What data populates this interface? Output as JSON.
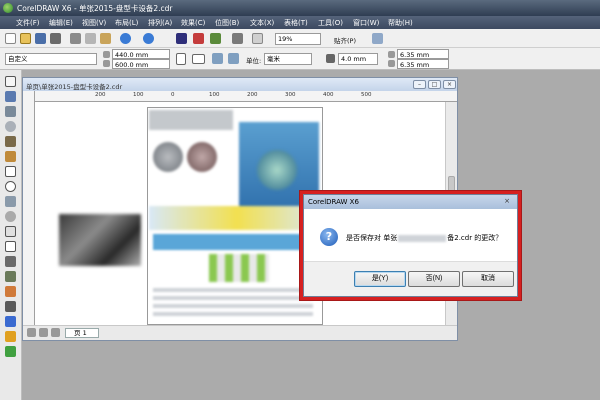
{
  "window": {
    "title": "CorelDRAW X6 - 单张2015-盘型卡设备2.cdr"
  },
  "menubar": {
    "items": [
      "文件(F)",
      "编辑(E)",
      "视图(V)",
      "布局(L)",
      "排列(A)",
      "效果(C)",
      "位图(B)",
      "文本(X)",
      "表格(T)",
      "工具(O)",
      "窗口(W)",
      "帮助(H)"
    ]
  },
  "toolbar": {
    "zoom": "19%",
    "snap_label": "贴齐(P)"
  },
  "propbar": {
    "preset": "自定义",
    "width": "440.0 mm",
    "height": "600.0 mm",
    "unit_label": "单位:",
    "unit_value": "毫米",
    "nudge": "4.0 mm",
    "dup_x": "6.35 mm",
    "dup_y": "6.35 mm"
  },
  "document": {
    "title": "单页\\单张2015-盘型卡设备2.cdr",
    "page_tab": "页 1",
    "ruler_labels": [
      "200",
      "100",
      "0",
      "100",
      "200",
      "300",
      "400",
      "500"
    ]
  },
  "dialog": {
    "title": "CorelDRAW X6",
    "message_prefix": "是否保存对 单张",
    "message_suffix": "备2.cdr 的更改？",
    "buttons": {
      "yes": "是(Y)",
      "no": "否(N)",
      "cancel": "取消"
    }
  },
  "colors": {
    "highlight": "#d62020",
    "titlebar": "#3c4960"
  }
}
